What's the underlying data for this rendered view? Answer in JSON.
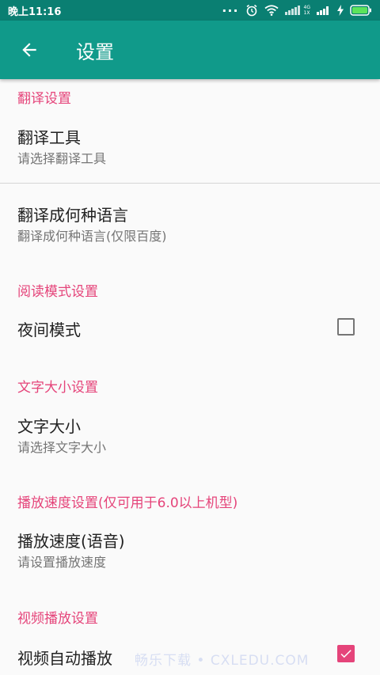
{
  "status_bar": {
    "time": "晚上11:16",
    "dots": "...",
    "net_top": "4G",
    "net_bottom": "1X"
  },
  "app_bar": {
    "title": "设置"
  },
  "sections": {
    "translate": {
      "header": "翻译设置",
      "tool_title": "翻译工具",
      "tool_sub": "请选择翻译工具",
      "lang_title": "翻译成何种语言",
      "lang_sub": "翻译成何种语言(仅限百度)"
    },
    "reading": {
      "header": "阅读模式设置",
      "night_title": "夜间模式",
      "night_checked": false
    },
    "text_size": {
      "header": "文字大小设置",
      "size_title": "文字大小",
      "size_sub": "请选择文字大小"
    },
    "speed": {
      "header": "播放速度设置(仅可用于6.0以上机型)",
      "speed_title": "播放速度(语音)",
      "speed_sub": "请设置播放速度"
    },
    "video": {
      "header": "视频播放设置",
      "autoplay_title": "视频自动播放",
      "autoplay_checked": true
    }
  },
  "watermark": "畅乐下载 • CXLEDU.COM",
  "colors": {
    "status_bar": "#0a7f72",
    "app_bar": "#109a8a",
    "accent": "#e5447a",
    "background": "#fafafa"
  }
}
